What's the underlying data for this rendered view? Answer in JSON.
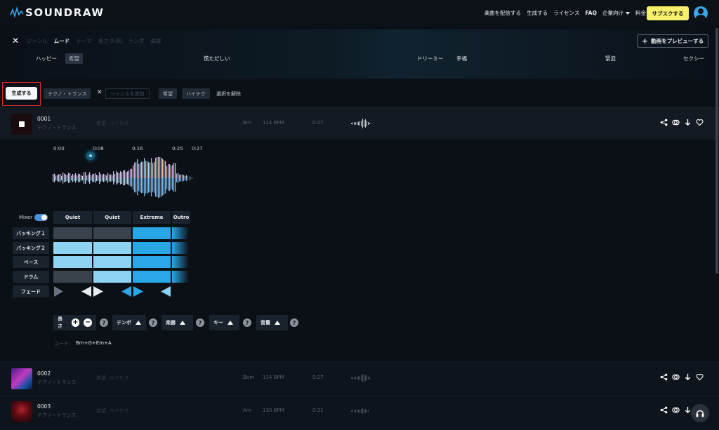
{
  "brand": {
    "name": "SOUNDRAW"
  },
  "nav": {
    "links": [
      "楽曲を配信する",
      "生成する",
      "ライセンス",
      "FAQ",
      "企業向け",
      "料金"
    ],
    "subscribe": "サブスクする"
  },
  "filters": {
    "tabs": [
      {
        "label": "ジャンル",
        "active": false
      },
      {
        "label": "ムード",
        "active": true
      },
      {
        "label": "テーマ",
        "active": false
      },
      {
        "label": "長さ 0:30",
        "active": false
      },
      {
        "label": "テンポ",
        "active": false
      },
      {
        "label": "楽器",
        "active": false
      }
    ],
    "preview_button": "動画をプレビューする",
    "moods_visible": [
      "ハッピー",
      "希望",
      "慌ただしい",
      "ドリーミー",
      "幸福",
      "緊迫",
      "セクシー"
    ]
  },
  "selection": {
    "generate_button": "生成する",
    "genre_chip": "テクノ・トランス",
    "add_genre_placeholder": "ジャンルを追加",
    "mood_chips": [
      "希望",
      "ハイテク"
    ],
    "clear_selection": "選択を解除"
  },
  "tracks": [
    {
      "id": "0001",
      "genre": "テクノ・トランス",
      "moods": "希望, ハイテク",
      "key": "Bm",
      "bpm": "114 BPM",
      "duration": "0:27"
    },
    {
      "id": "0002",
      "genre": "テクノ・トランス",
      "moods": "希望, ハイテク",
      "key": "Bbm",
      "bpm": "114 BPM",
      "duration": "0:27"
    },
    {
      "id": "0003",
      "genre": "テクノ・トランス",
      "moods": "希望, ハイテク",
      "key": "Am",
      "bpm": "130 BPM",
      "duration": "0:31"
    }
  ],
  "player": {
    "time_labels": [
      "0:00",
      "0:08",
      "0:16",
      "0:25",
      "0:27"
    ]
  },
  "mixer": {
    "label": "Mixer",
    "sections": [
      "Quiet",
      "Quiet",
      "Extreme",
      "Outro"
    ],
    "rows": [
      "バッキング１",
      "バッキング２",
      "ベース",
      "ドラム",
      "フェード"
    ]
  },
  "controls": {
    "length": "長さ",
    "tempo": "テンポ",
    "instruments": "楽器",
    "key": "キー",
    "volume": "音量",
    "help": "?",
    "chord_label": "コード:",
    "chord_value": "Bm+G+Em+A"
  },
  "colors": {
    "accent_yellow": "#f7f06a",
    "mixer_bright": "#2aa7e6",
    "mixer_light": "#8fd3f2",
    "mixer_dark": "#3a434c",
    "highlight_red": "#e02a2a"
  }
}
